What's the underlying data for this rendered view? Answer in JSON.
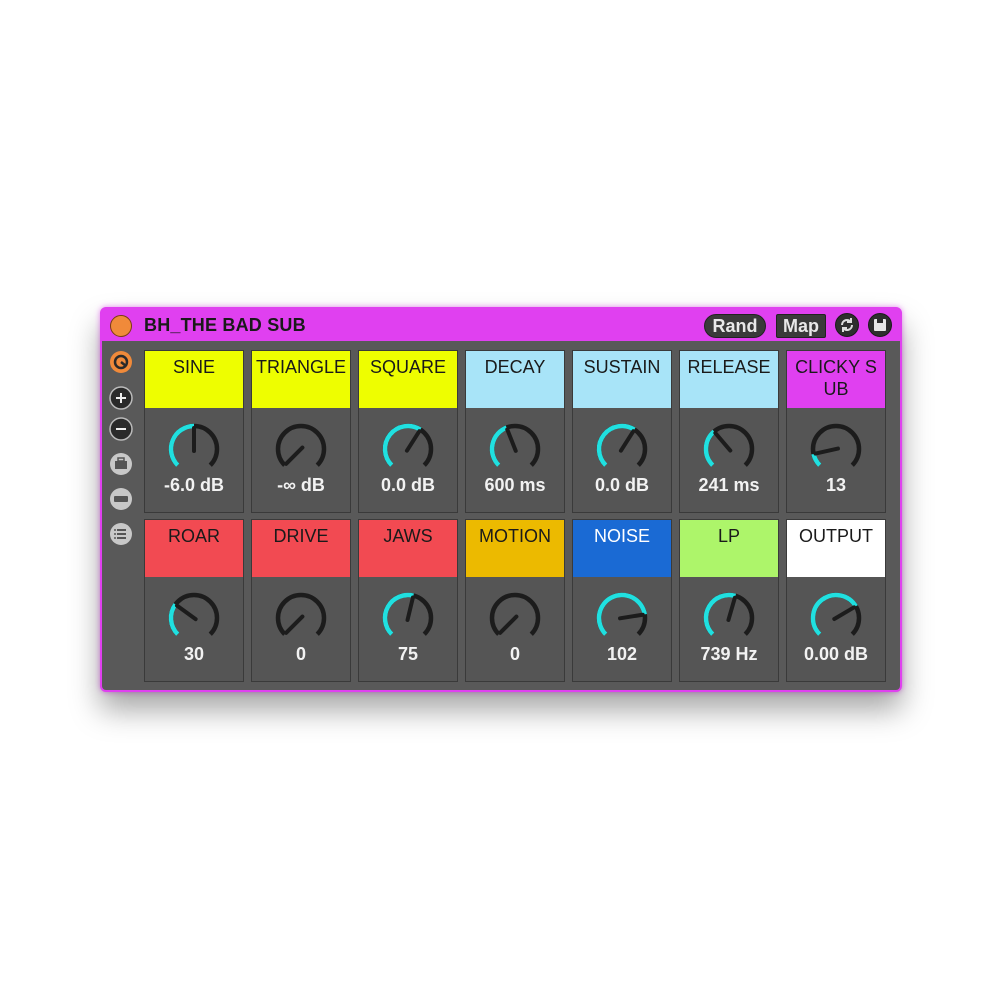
{
  "device": {
    "title": "BH_THE BAD SUB",
    "rand_label": "Rand",
    "map_label": "Map",
    "colors": {
      "frame": "#e040f0",
      "panel": "#595959",
      "knob_arc": "#20e0e0",
      "power": "#f08a3a"
    }
  },
  "toolbar_icons": [
    "power-icon",
    "refresh-icon",
    "save-icon"
  ],
  "sidebar": [
    "hot-swap-icon",
    "plus-icon",
    "minus-icon",
    "toolbox-icon",
    "strip-icon",
    "list-icon"
  ],
  "rows": [
    [
      {
        "name": "SINE",
        "value": "-6.0 dB",
        "color": "#eefe00",
        "text_color": "#1a1a1a",
        "level": 0.5
      },
      {
        "name": "TRIANGLE",
        "value": "-∞ dB",
        "color": "#eefe00",
        "text_color": "#1a1a1a",
        "level": 0.0
      },
      {
        "name": "SQUARE",
        "value": "0.0 dB",
        "color": "#eefe00",
        "text_color": "#1a1a1a",
        "level": 0.62
      },
      {
        "name": "DECAY",
        "value": "600 ms",
        "color": "#a8e4f8",
        "text_color": "#1a1a1a",
        "level": 0.42
      },
      {
        "name": "SUSTAIN",
        "value": "0.0 dB",
        "color": "#a8e4f8",
        "text_color": "#1a1a1a",
        "level": 0.62
      },
      {
        "name": "RELEASE",
        "value": "241 ms",
        "color": "#a8e4f8",
        "text_color": "#1a1a1a",
        "level": 0.35
      },
      {
        "name": "CLICKY SUB",
        "value": "13",
        "color": "#e040f0",
        "text_color": "#1a1a1a",
        "level": 0.12
      }
    ],
    [
      {
        "name": "ROAR",
        "value": "30",
        "color": "#f24a52",
        "text_color": "#1a1a1a",
        "level": 0.3
      },
      {
        "name": "DRIVE",
        "value": "0",
        "color": "#f24a52",
        "text_color": "#1a1a1a",
        "level": 0.0
      },
      {
        "name": "JAWS",
        "value": "75",
        "color": "#f24a52",
        "text_color": "#1a1a1a",
        "level": 0.55
      },
      {
        "name": "MOTION",
        "value": "0",
        "color": "#ecba00",
        "text_color": "#1a1a1a",
        "level": 0.0
      },
      {
        "name": "NOISE",
        "value": "102",
        "color": "#1a6ad4",
        "text_color": "#ffffff",
        "level": 0.8
      },
      {
        "name": "LP",
        "value": "739 Hz",
        "color": "#adf56a",
        "text_color": "#1a1a1a",
        "level": 0.56
      },
      {
        "name": "OUTPUT",
        "value": "0.00 dB",
        "color": "#ffffff",
        "text_color": "#1a1a1a",
        "level": 0.72
      }
    ]
  ]
}
